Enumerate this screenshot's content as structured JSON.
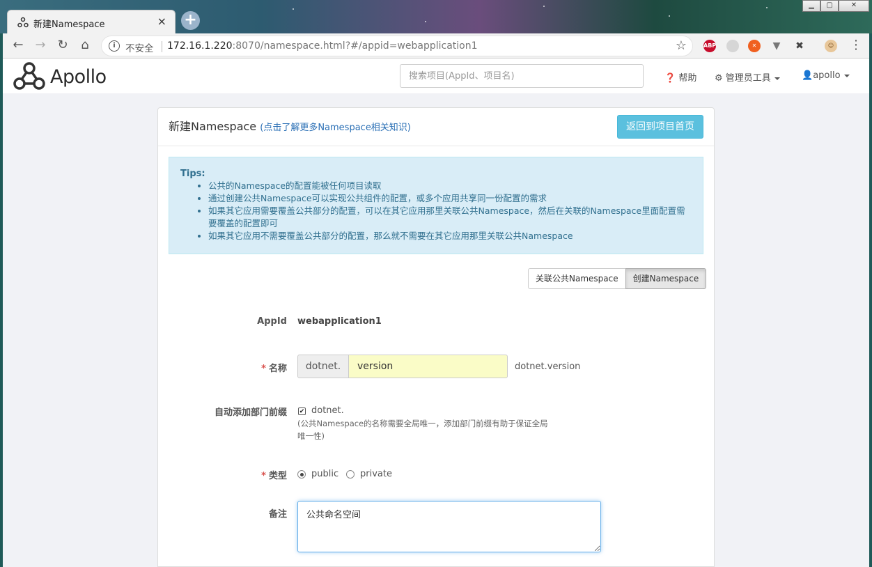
{
  "browser": {
    "tab_title": "新建Namespace",
    "tab_close": "×",
    "new_tab": "+",
    "insecure_label": "不安全",
    "url_host": "172.16.1.220",
    "url_rest": ":8070/namespace.html?#/appid=webapplication1",
    "window_controls": {
      "minimize": "▁",
      "maximize": "▢",
      "close": "✕"
    },
    "ext_abp_label": "ABP",
    "icons": [
      "back-icon",
      "forward-icon",
      "reload-icon",
      "home-icon",
      "info-icon",
      "bookmark-star-icon",
      "adblock-icon",
      "sync-icon",
      "extension-icon",
      "vue-icon",
      "devtools-icon",
      "profile-icon",
      "menu-icon"
    ]
  },
  "header": {
    "brand": "Apollo",
    "search_placeholder": "搜索项目(AppId、项目名)",
    "help": "帮助",
    "admin_tools": "管理员工具",
    "user": "apollo"
  },
  "panel": {
    "title": "新建Namespace",
    "help_link": "(点击了解更多Namespace相关知识)",
    "back_button": "返回到项目首页"
  },
  "tips": {
    "title": "Tips:",
    "items": [
      "公共的Namespace的配置能被任何项目读取",
      "通过创建公共Namespace可以实现公共组件的配置，或多个应用共享同一份配置的需求",
      "如果其它应用需要覆盖公共部分的配置，可以在其它应用那里关联公共Namespace，然后在关联的Namespace里面配置需要覆盖的配置即可",
      "如果其它应用不需要覆盖公共部分的配置，那么就不需要在其它应用那里关联公共Namespace"
    ]
  },
  "mode_toggle": {
    "link_public": "关联公共Namespace",
    "create": "创建Namespace",
    "active": "create"
  },
  "form": {
    "appid_label": "AppId",
    "appid_value": "webapplication1",
    "required_mark": "*",
    "name_label": "名称",
    "name_prefix": "dotnet.",
    "name_value": "version",
    "name_full": "dotnet.version",
    "auto_prefix_label": "自动添加部门前缀",
    "auto_prefix_checked": true,
    "auto_prefix_value": "dotnet.",
    "auto_prefix_check_glyph": "✔",
    "auto_prefix_help": "(公共Namespace的名称需要全局唯一，添加部门前缀有助于保证全局唯一性)",
    "type_label": "类型",
    "type_options": [
      "public",
      "private"
    ],
    "type_selected": "public",
    "comment_label": "备注",
    "comment_value": "公共命名空间"
  },
  "colors": {
    "info_button": "#5bc0de",
    "tips_bg": "#d9edf7",
    "tips_text": "#31708f",
    "link": "#2a6fb5",
    "required": "#d9534f",
    "autofill_bg": "#fafcc7"
  }
}
